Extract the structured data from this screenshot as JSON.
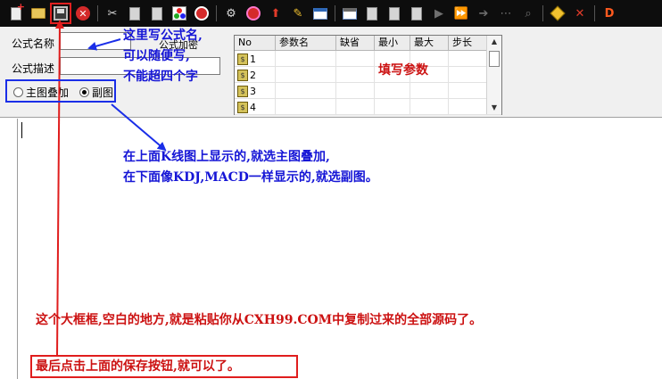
{
  "toolbar": {
    "buttons": [
      {
        "name": "new-formula-icon"
      },
      {
        "name": "open-folder-icon"
      },
      {
        "name": "save-icon"
      },
      {
        "name": "close-red-icon"
      },
      {
        "name": "cut-icon"
      },
      {
        "name": "copy-icon"
      },
      {
        "name": "paste-icon"
      },
      {
        "name": "color-palette-icon"
      },
      {
        "name": "import-icon"
      },
      {
        "name": "function-icon"
      },
      {
        "name": "stop-icon"
      },
      {
        "name": "up-arrow-icon"
      },
      {
        "name": "magic-wand-icon"
      },
      {
        "name": "window-form-icon"
      },
      {
        "name": "image-icon"
      },
      {
        "name": "doc-1-icon"
      },
      {
        "name": "doc-2-icon"
      },
      {
        "name": "doc-3-icon"
      },
      {
        "name": "play-icon"
      },
      {
        "name": "fast-forward-icon"
      },
      {
        "name": "step-over-icon"
      },
      {
        "name": "step-icon"
      },
      {
        "name": "search-icon"
      },
      {
        "name": "help-icon"
      },
      {
        "name": "close-x-icon"
      },
      {
        "name": "d-icon"
      }
    ],
    "d_label": "D"
  },
  "form": {
    "name_label": "公式名称",
    "desc_label": "公式描述",
    "encrypt_label": "公式加密",
    "radio_main": "主图叠加",
    "radio_sub": "副图",
    "radio_selected": "副图"
  },
  "params": {
    "headers": [
      "No",
      "参数名",
      "缺省",
      "最小",
      "最大",
      "步长"
    ],
    "rows": [
      {
        "no": "1"
      },
      {
        "no": "2"
      },
      {
        "no": "3"
      },
      {
        "no": "4"
      }
    ]
  },
  "annotations": {
    "name_hint": [
      "这里写公式名,",
      "可以随便写,",
      "不能超四个字"
    ],
    "param_hint": "填写参数",
    "overlay_hint": [
      "在上面K线图上显示的,就选主图叠加,",
      "在下面像KDJ,MACD一样显示的,就选副图。"
    ],
    "editor_hint": "这个大框框,空白的地方,就是粘贴你从CXH99.COM中复制过来的全部源码了。",
    "save_hint": "最后点击上面的保存按钮,就可以了。"
  },
  "colors": {
    "annotation_blue": "#1515d6",
    "annotation_red": "#cc1212",
    "toolbar_bg": "#0d0d0d"
  }
}
